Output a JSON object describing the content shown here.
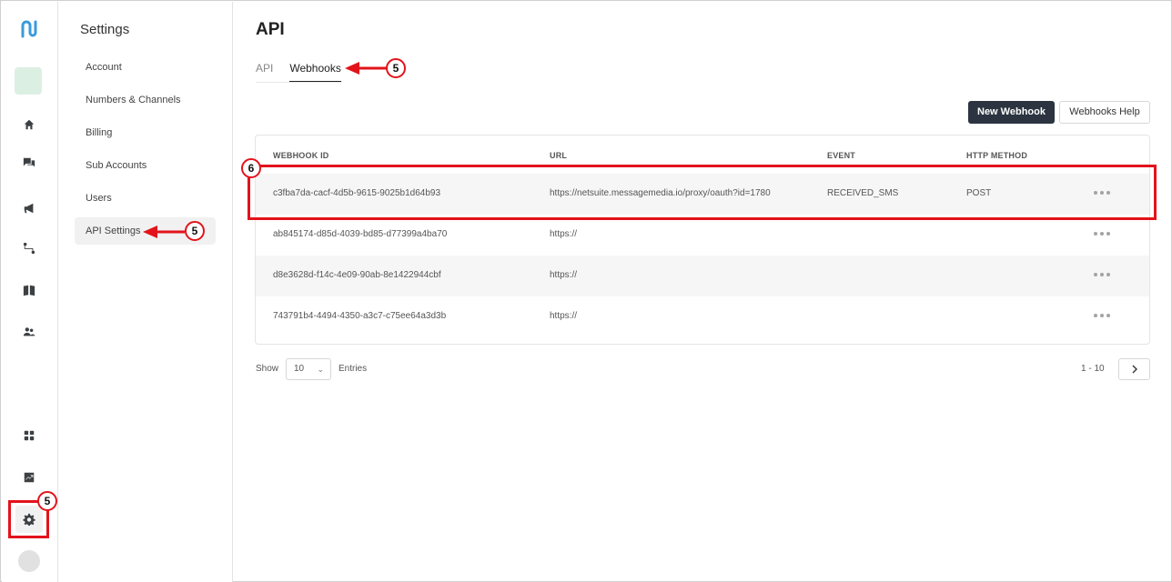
{
  "rail": {
    "icons": [
      "logo-icon",
      "home-icon",
      "chat-icon",
      "megaphone-icon",
      "flow-icon",
      "book-icon",
      "users-icon",
      "apps-icon",
      "chart-icon",
      "gear-icon"
    ]
  },
  "submenu": {
    "title": "Settings",
    "items": [
      {
        "label": "Account"
      },
      {
        "label": "Numbers & Channels"
      },
      {
        "label": "Billing"
      },
      {
        "label": "Sub Accounts"
      },
      {
        "label": "Users"
      },
      {
        "label": "API Settings",
        "active": true
      }
    ]
  },
  "main": {
    "title": "API",
    "tabs": [
      {
        "label": "API"
      },
      {
        "label": "Webhooks",
        "active": true
      }
    ],
    "buttons": {
      "new_webhook": "New Webhook",
      "webhooks_help": "Webhooks Help"
    },
    "table": {
      "headers": [
        "WEBHOOK ID",
        "URL",
        "EVENT",
        "HTTP METHOD"
      ],
      "rows": [
        {
          "id": "c3fba7da-cacf-4d5b-9615-9025b1d64b93",
          "url": "https://netsuite.messagemedia.io/proxy/oauth?id=1780",
          "event": "RECEIVED_SMS",
          "method": "POST"
        },
        {
          "id": "ab845174-d85d-4039-bd85-d77399a4ba70",
          "url": "https://",
          "event": "",
          "method": ""
        },
        {
          "id": "d8e3628d-f14c-4e09-90ab-8e1422944cbf",
          "url": "https://",
          "event": "",
          "method": ""
        },
        {
          "id": "743791b4-4494-4350-a3c7-c75ee64a3d3b",
          "url": "https://",
          "event": "",
          "method": ""
        }
      ]
    },
    "pagination": {
      "show_label": "Show",
      "entries_value": "10",
      "entries_label": "Entries",
      "page_info": "1 - 10"
    }
  },
  "annotations": {
    "badge_5": "5",
    "badge_6": "6",
    "color": "#e3131b"
  }
}
